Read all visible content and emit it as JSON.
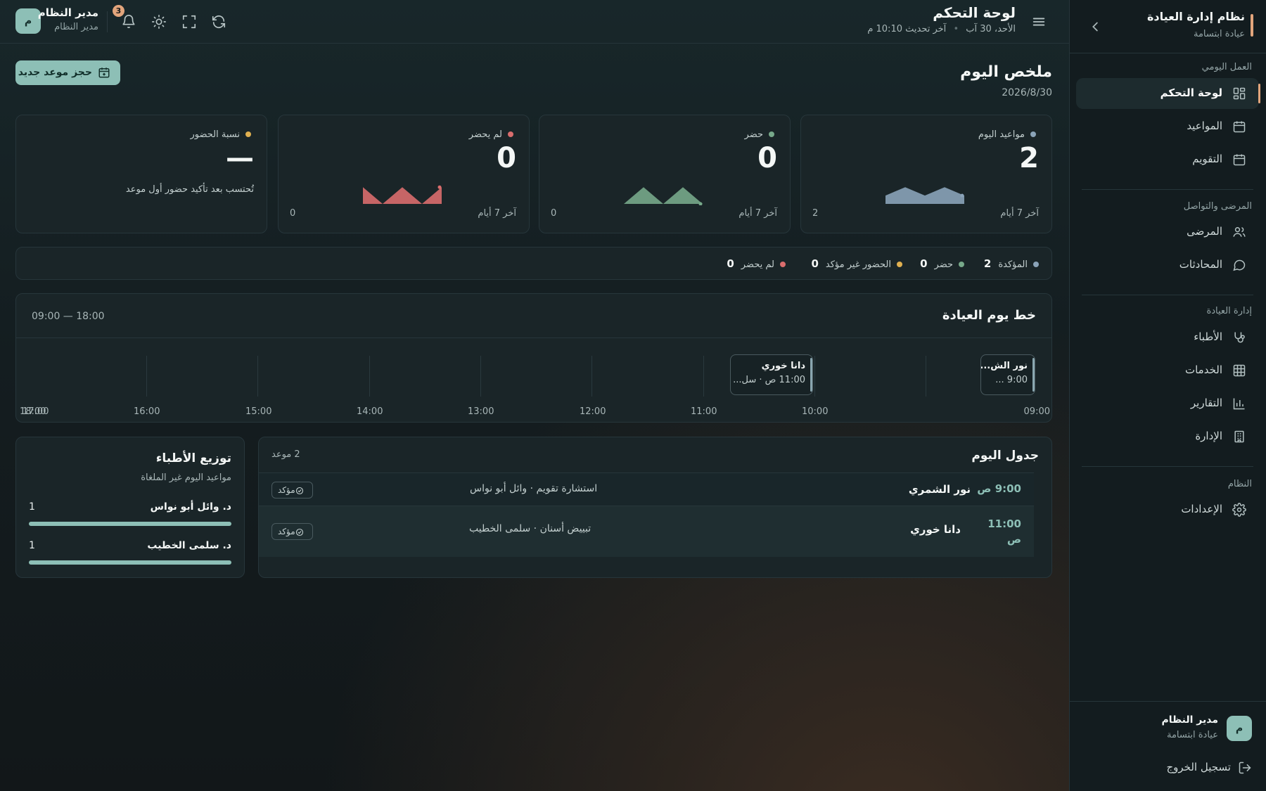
{
  "sidebar": {
    "title": "نظام إدارة العيادة",
    "subtitle": "عيادة ابتسامة",
    "sections": [
      {
        "label": "العمل اليومي",
        "items": [
          {
            "label": "لوحة التحكم",
            "icon": "dashboard-icon",
            "active": true
          },
          {
            "label": "المواعيد",
            "icon": "calendar-grid-icon"
          },
          {
            "label": "التقويم",
            "icon": "calendar-icon"
          }
        ]
      },
      {
        "label": "المرضى والتواصل",
        "items": [
          {
            "label": "المرضى",
            "icon": "users-icon"
          },
          {
            "label": "المحادثات",
            "icon": "chat-icon"
          }
        ]
      },
      {
        "label": "إدارة العيادة",
        "items": [
          {
            "label": "الأطباء",
            "icon": "stethoscope-icon"
          },
          {
            "label": "الخدمات",
            "icon": "grid-icon"
          },
          {
            "label": "التقارير",
            "icon": "bar-chart-icon"
          },
          {
            "label": "الإدارة",
            "icon": "building-icon"
          }
        ]
      },
      {
        "label": "النظام",
        "items": [
          {
            "label": "الإعدادات",
            "icon": "gear-icon"
          }
        ]
      }
    ],
    "user": {
      "name": "مدير النظام",
      "clinic": "عيادة ابتسامة",
      "avatar": "م"
    },
    "logout": "تسجيل الخروج"
  },
  "topbar": {
    "title": "لوحة التحكم",
    "date": "الأحد، 30 آب",
    "separator": "•",
    "updated": "آخر تحديث 10:10 م",
    "user_name": "مدير النظام",
    "user_role": "مدير النظام",
    "avatar": "م",
    "notifications": "3"
  },
  "summary": {
    "title": "ملخص اليوم",
    "date": "2026/8/30",
    "new_button": "حجز موعد جديد"
  },
  "stats": [
    {
      "title": "مواعيد اليوم",
      "value": "2",
      "foot": "آخر 7 أيام",
      "min": "2",
      "color": "#8aa3b8",
      "spark": [
        1,
        2,
        1,
        2,
        1
      ]
    },
    {
      "title": "حضر",
      "value": "0",
      "foot": "آخر 7 أيام",
      "min": "0",
      "color": "#77a98a",
      "spark": [
        0,
        1,
        0,
        1,
        0
      ]
    },
    {
      "title": "لم يحضر",
      "value": "0",
      "foot": "آخر 7 أيام",
      "min": "0",
      "color": "#d96d6d",
      "spark": [
        1,
        0,
        1,
        0,
        1
      ]
    },
    {
      "title": "نسبة الحضور",
      "value": "—",
      "note": "تُحتسب بعد تأكيد حضور أول موعد",
      "color": "#e0b050"
    }
  ],
  "legend": [
    {
      "label": "المؤكدة",
      "value": "2",
      "color": "#8aa3b8"
    },
    {
      "label": "حضر",
      "value": "0",
      "color": "#77a98a"
    },
    {
      "label": "الحضور غير مؤكد",
      "value": "0",
      "color": "#e0b050"
    },
    {
      "label": "لم يحضر",
      "value": "0",
      "color": "#d96d6d"
    }
  ],
  "timeline": {
    "title": "خط يوم العيادة",
    "range": "09:00 — 18:00",
    "hours": [
      "09:00",
      "10:00",
      "11:00",
      "12:00",
      "13:00",
      "14:00",
      "15:00",
      "16:00",
      "17:00",
      "18:00"
    ],
    "appointments": [
      {
        "name": "نور الش...",
        "detail": "9:00 ..."
      },
      {
        "name": "دانا خوري",
        "detail": "11:00 ص · سل..."
      }
    ]
  },
  "schedule": {
    "title": "جدول اليوم",
    "count": "2 موعد",
    "rows": [
      {
        "time": "9:00 ص",
        "patient": "نور الشمري",
        "service": "استشارة تقويم · وائل أبو نواس",
        "status": "مؤكد"
      },
      {
        "time": "11:00 ص",
        "patient": "دانا خوري",
        "service": "تبييض أسنان · سلمى الخطيب",
        "status": "مؤكد"
      }
    ]
  },
  "doctors": {
    "title": "توزيع الأطباء",
    "subtitle": "مواعيد اليوم غير الملغاة",
    "items": [
      {
        "name": "د. وائل أبو نواس",
        "count": "1",
        "share": 1.0
      },
      {
        "name": "د. سلمى الخطيب",
        "count": "1",
        "share": 1.0
      }
    ]
  }
}
